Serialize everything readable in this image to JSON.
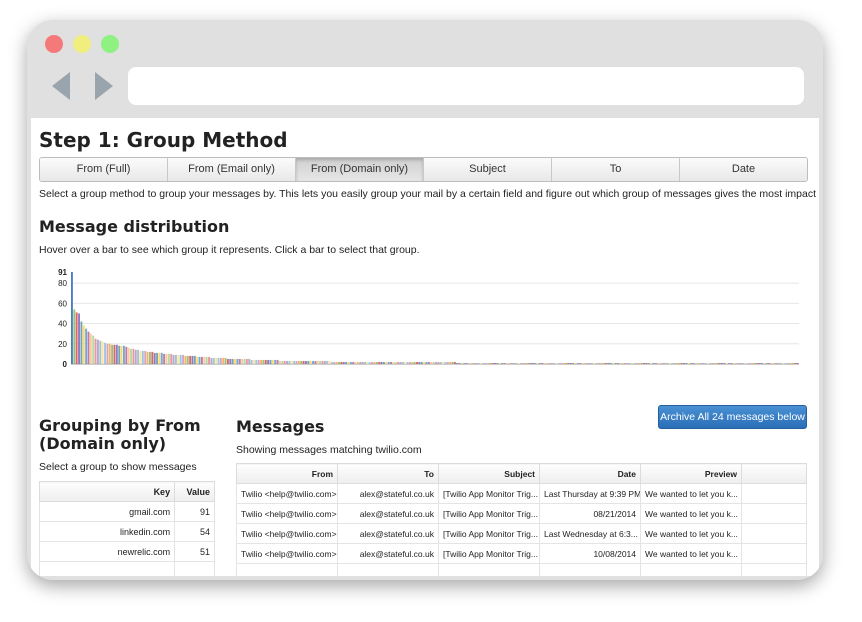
{
  "page": {
    "title": "Step 1: Group Method",
    "tabs": [
      {
        "label": "From (Full)",
        "active": false
      },
      {
        "label": "From (Email only)",
        "active": false
      },
      {
        "label": "From (Domain only)",
        "active": true
      },
      {
        "label": "Subject",
        "active": false
      },
      {
        "label": "To",
        "active": false
      },
      {
        "label": "Date",
        "active": false
      }
    ],
    "description": "Select a group method to group your messages by. This lets you easily group your mail by a certain field and figure out which group of messages gives the most impact to archive."
  },
  "distribution": {
    "heading": "Message distribution",
    "hint": "Hover over a bar to see which group it represents. Click a bar to select that group."
  },
  "chart_data": {
    "type": "bar",
    "ymax_label": "91",
    "yticks": [
      "80",
      "60",
      "40",
      "20",
      "0"
    ],
    "ylim": [
      0,
      91
    ],
    "grid": true,
    "values": [
      91,
      54,
      51,
      50,
      42,
      38,
      35,
      32,
      30,
      28,
      25,
      24,
      23,
      22,
      21,
      20,
      20,
      19,
      19,
      19,
      18,
      18,
      18,
      17,
      16,
      15,
      15,
      14,
      14,
      13,
      13,
      13,
      12,
      12,
      12,
      11,
      11,
      11,
      11,
      10,
      10,
      10,
      10,
      9,
      9,
      9,
      9,
      9,
      8,
      8,
      8,
      8,
      8,
      7,
      7,
      7,
      7,
      7,
      7,
      6,
      6,
      6,
      6,
      6,
      6,
      6,
      5,
      5,
      5,
      5,
      5,
      5,
      5,
      5,
      5,
      5,
      4,
      4,
      4,
      4,
      4,
      4,
      4,
      4,
      4,
      4,
      4,
      4,
      3,
      3,
      3,
      3,
      3,
      3,
      3,
      3,
      3,
      3,
      3,
      3,
      3,
      3,
      3,
      3,
      3,
      3,
      3,
      3,
      3,
      3,
      2,
      2,
      2,
      2,
      2,
      2,
      2,
      2,
      2,
      2,
      2,
      2,
      2,
      2,
      2,
      2,
      2,
      2,
      2,
      2,
      2,
      2,
      2,
      2,
      2,
      2,
      2,
      2,
      2,
      2,
      2,
      2,
      2,
      2,
      2,
      2,
      2,
      2,
      2,
      2,
      2,
      2,
      2,
      2,
      2,
      2,
      2,
      2,
      2,
      2,
      2,
      2,
      2,
      1,
      1,
      1,
      1,
      1,
      1,
      1,
      1,
      1,
      1,
      1,
      1,
      1,
      1,
      1,
      1,
      1,
      1,
      1,
      1,
      1,
      1,
      1,
      1,
      1,
      1,
      1,
      1,
      1,
      1,
      1,
      1,
      1,
      1,
      1,
      1,
      1,
      1,
      1,
      1,
      1,
      1,
      1,
      1,
      1,
      1,
      1,
      1,
      1,
      1,
      1,
      1,
      1,
      1,
      1,
      1,
      1,
      1,
      1,
      1,
      1,
      1,
      1,
      1,
      1,
      1,
      1,
      1,
      1,
      1,
      1,
      1,
      1,
      1,
      1,
      1,
      1,
      1,
      1,
      1,
      1,
      1,
      1,
      1,
      1,
      1,
      1,
      1,
      1,
      1,
      1,
      1,
      1,
      1,
      1,
      1,
      1,
      1,
      1,
      1,
      1,
      1,
      1,
      1,
      1,
      1,
      1,
      1,
      1,
      1,
      1,
      1,
      1,
      1,
      1,
      1,
      1,
      1,
      1,
      1,
      1,
      1,
      1,
      1,
      1,
      1,
      1,
      1,
      1,
      1,
      1,
      1,
      1,
      1,
      1,
      1,
      1,
      1,
      1,
      1,
      1,
      1,
      1,
      1,
      1
    ],
    "highlight_color": "#4a7fc0",
    "palette": [
      "#f6b26b",
      "#93c47d",
      "#e06666",
      "#8e7cc3",
      "#76a5af",
      "#ffd966",
      "#6fa8dc",
      "#c27ba0",
      "#f9cb9c",
      "#b6d7a8",
      "#ea9999",
      "#b4a7d6",
      "#a2c4c9",
      "#ffe599",
      "#9fc5e8",
      "#d5a6bd"
    ]
  },
  "grouping": {
    "heading_line1": "Grouping by From",
    "heading_line2": "(Domain only)",
    "hint": "Select a group to show messages",
    "columns": [
      "Key",
      "Value"
    ],
    "rows": [
      {
        "key": "gmail.com",
        "value": "91"
      },
      {
        "key": "linkedin.com",
        "value": "54"
      },
      {
        "key": "newrelic.com",
        "value": "51"
      },
      {
        "key": "",
        "value": ""
      }
    ]
  },
  "messages": {
    "heading": "Messages",
    "subtitle": "Showing messages matching twilio.com",
    "archive_label": "Archive All 24 messages below",
    "columns": [
      "From",
      "To",
      "Subject",
      "Date",
      "Preview"
    ],
    "rows": [
      {
        "from": "Twilio <help@twilio.com>",
        "to": "alex@stateful.co.uk",
        "subject": "[Twilio App Monitor Trig...",
        "date": "Last Thursday at 9:39 PM",
        "preview": "We wanted to let you k..."
      },
      {
        "from": "Twilio <help@twilio.com>",
        "to": "alex@stateful.co.uk",
        "subject": "[Twilio App Monitor Trig...",
        "date": "08/21/2014",
        "preview": "We wanted to let you k..."
      },
      {
        "from": "Twilio <help@twilio.com>",
        "to": "alex@stateful.co.uk",
        "subject": "[Twilio App Monitor Trig...",
        "date": "Last Wednesday at 6:3...",
        "preview": "We wanted to let you k..."
      },
      {
        "from": "Twilio <help@twilio.com>",
        "to": "alex@stateful.co.uk",
        "subject": "[Twilio App Monitor Trig...",
        "date": "10/08/2014",
        "preview": "We wanted to let you k..."
      },
      {
        "from": "",
        "to": "",
        "subject": "",
        "date": "",
        "preview": ""
      }
    ]
  }
}
